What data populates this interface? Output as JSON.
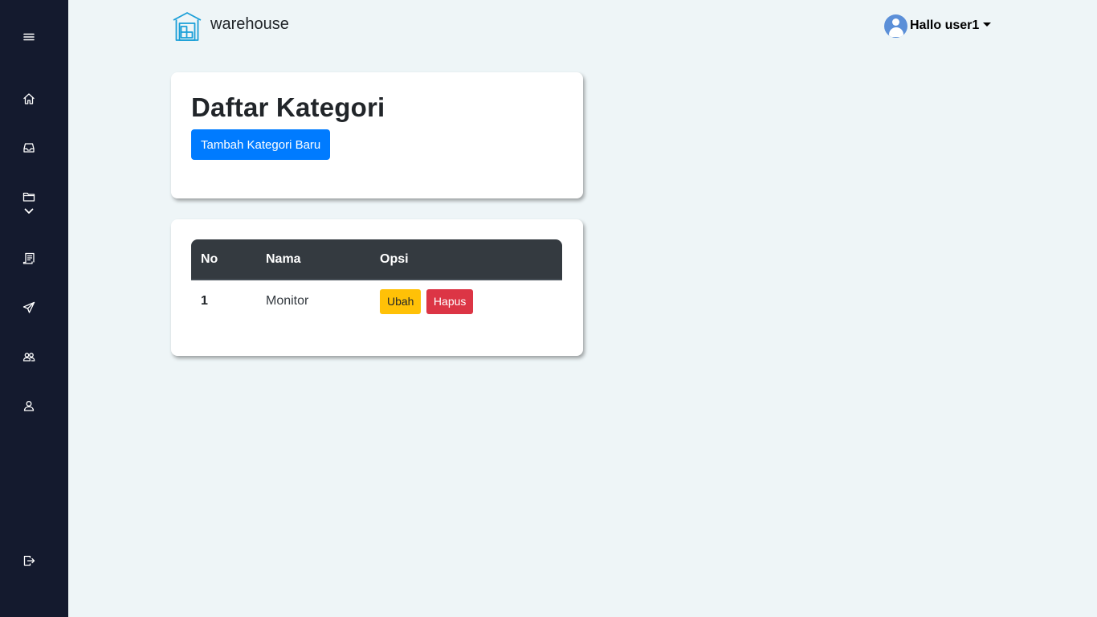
{
  "brand": {
    "name": "warehouse",
    "logo_icon": "warehouse-icon",
    "logo_color": "#1a9fd8"
  },
  "user": {
    "greeting": "Hallo user1",
    "avatar_icon": "user-circle-icon"
  },
  "sidebar": {
    "items": [
      {
        "name": "menu",
        "icon": "hamburger-icon"
      },
      {
        "name": "home",
        "icon": "home-icon"
      },
      {
        "name": "inbox",
        "icon": "inbox-icon"
      },
      {
        "name": "folder",
        "icon": "folder-icon",
        "expandable": true
      },
      {
        "name": "report",
        "icon": "receipt-icon"
      },
      {
        "name": "send",
        "icon": "send-icon"
      },
      {
        "name": "users",
        "icon": "people-icon"
      },
      {
        "name": "profile",
        "icon": "person-icon"
      },
      {
        "name": "logout",
        "icon": "logout-icon"
      }
    ]
  },
  "page": {
    "title": "Daftar Kategori",
    "add_button": "Tambah Kategori Baru"
  },
  "table": {
    "headers": [
      "No",
      "Nama",
      "Opsi"
    ],
    "rows": [
      {
        "no": "1",
        "nama": "Monitor",
        "edit_label": "Ubah",
        "delete_label": "Hapus"
      }
    ]
  },
  "colors": {
    "sidebar_bg": "#141a2e",
    "page_bg": "#eef5f7",
    "primary": "#007bff",
    "warning": "#ffc107",
    "danger": "#dc3545",
    "table_header": "#343a40"
  }
}
